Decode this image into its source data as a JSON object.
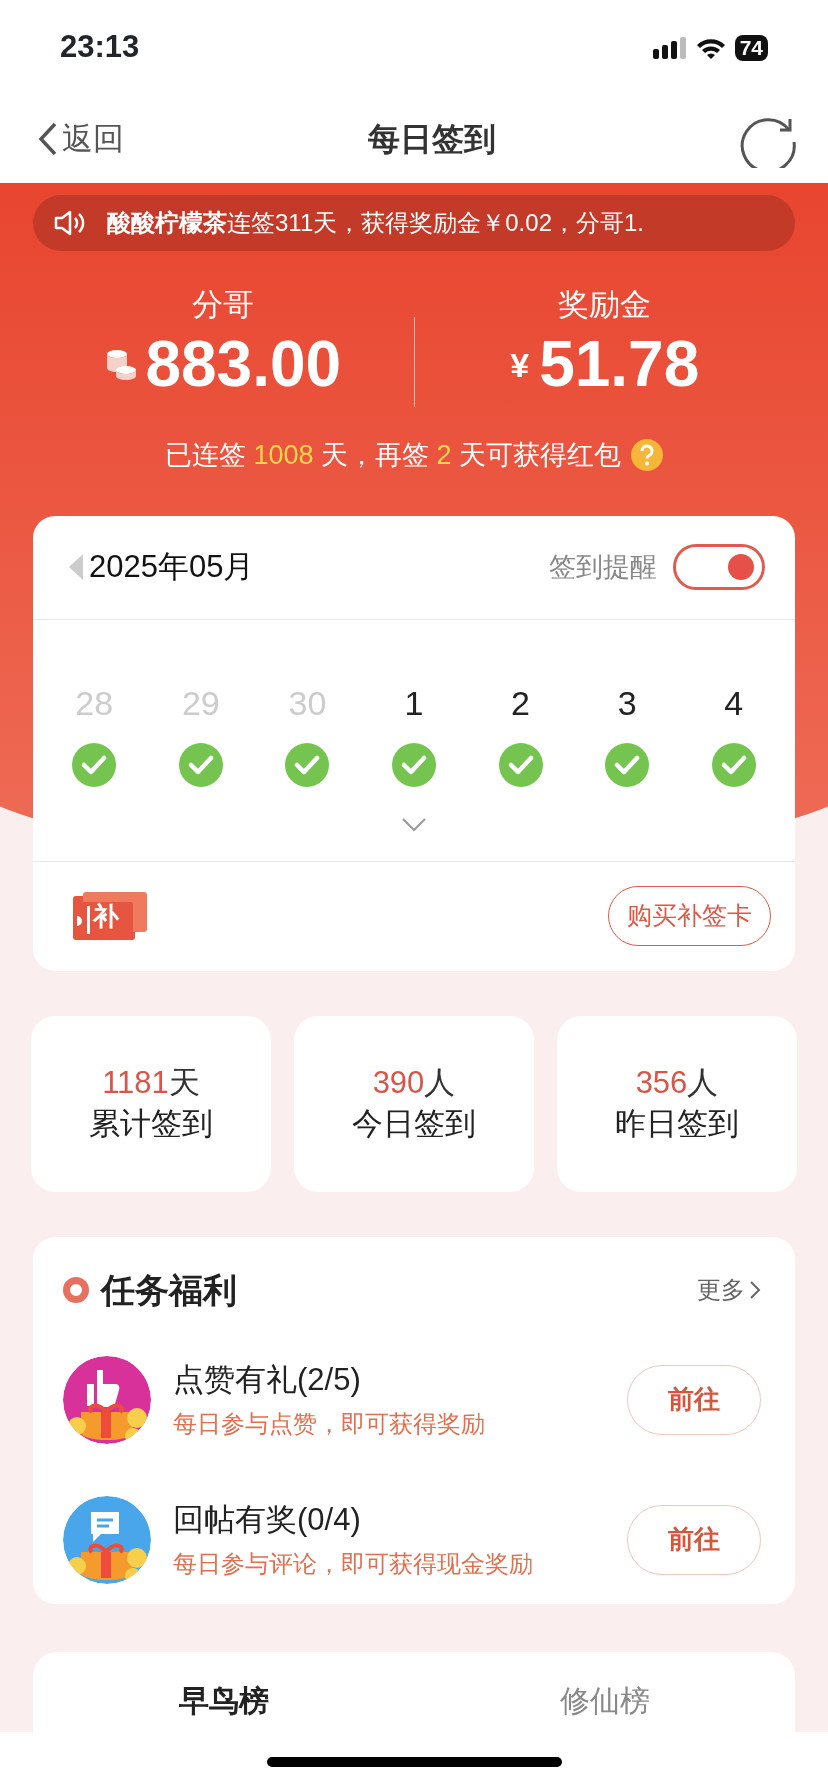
{
  "status_bar": {
    "time": "23:13",
    "battery": "74"
  },
  "nav": {
    "back": "返回",
    "title": "每日签到"
  },
  "notice": {
    "text": "**酸酸柠檬茶**连签311天，获得奖励金￥0.02，分哥1."
  },
  "balances": [
    {
      "label": "分哥",
      "kind": "coins",
      "value": "883.00"
    },
    {
      "label": "奖励金",
      "kind": "yuan",
      "symbol": "¥",
      "value": "51.78"
    }
  ],
  "streak": {
    "parts": [
      {
        "text": "已连签 ",
        "highlight": false
      },
      {
        "text": "1008",
        "highlight": true
      },
      {
        "text": " 天，再签 ",
        "highlight": false
      },
      {
        "text": "2",
        "highlight": true
      },
      {
        "text": " 天可获得红包",
        "highlight": false
      }
    ]
  },
  "calendar": {
    "month": "2025年05月",
    "reminder": {
      "label": "签到提醒",
      "on": true
    },
    "days": [
      {
        "day": "28",
        "other_month": true,
        "checked": true
      },
      {
        "day": "29",
        "other_month": true,
        "checked": true
      },
      {
        "day": "30",
        "other_month": true,
        "checked": true
      },
      {
        "day": "1",
        "other_month": false,
        "checked": true
      },
      {
        "day": "2",
        "other_month": false,
        "checked": true
      },
      {
        "day": "3",
        "other_month": false,
        "checked": true
      },
      {
        "day": "4",
        "other_month": false,
        "checked": true
      }
    ],
    "ticket_label": "补",
    "buy_button": "购买补签卡"
  },
  "stats": [
    {
      "value": "1181",
      "unit": "天",
      "label": "累计签到"
    },
    {
      "value": "390",
      "unit": "人",
      "label": "今日签到"
    },
    {
      "value": "356",
      "unit": "人",
      "label": "昨日签到"
    }
  ],
  "tasks": {
    "title": "任务福利",
    "more": "更多",
    "items": [
      {
        "kind": "like",
        "title": "点赞有礼(2/5)",
        "desc": "每日参与点赞，即可获得奖励",
        "button": "前往"
      },
      {
        "kind": "reply",
        "title": "回帖有奖(0/4)",
        "desc": "每日参与评论，即可获得现金奖励",
        "button": "前往"
      }
    ]
  },
  "ranks": {
    "tabs": [
      {
        "label": "早鸟榜",
        "selected": true
      },
      {
        "label": "修仙榜",
        "selected": false
      }
    ]
  }
}
